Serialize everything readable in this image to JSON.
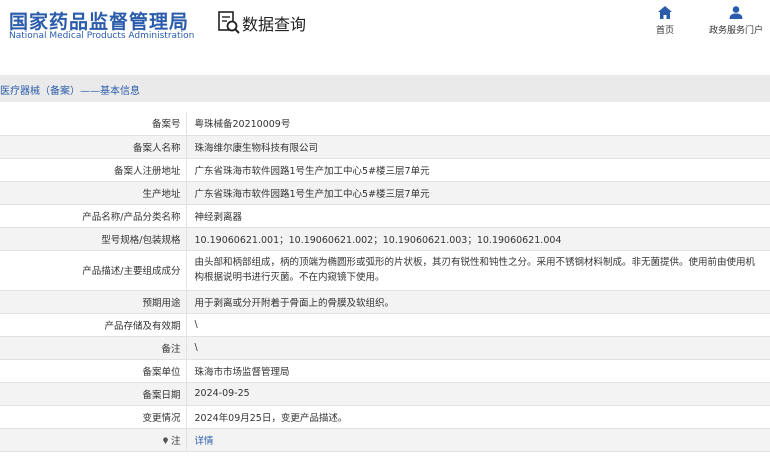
{
  "header": {
    "logo_cn": "国家药品监督管理局",
    "logo_en": "National Medical Products Administration",
    "query_title": "数据查询",
    "nav": {
      "home": "首页",
      "portal": "政务服务门户"
    }
  },
  "breadcrumb": "医疗器械（备案）——基本信息",
  "detail": {
    "rows": [
      {
        "label": "备案号",
        "value": "粤珠械备20210009号"
      },
      {
        "label": "备案人名称",
        "value": "珠海维尔康生物科技有限公司"
      },
      {
        "label": "备案人注册地址",
        "value": "广东省珠海市软件园路1号生产加工中心5#楼三层7单元"
      },
      {
        "label": "生产地址",
        "value": "广东省珠海市软件园路1号生产加工中心5#楼三层7单元"
      },
      {
        "label": "产品名称/产品分类名称",
        "value": "神经剥离器"
      },
      {
        "label": "型号规格/包装规格",
        "value": "10.19060621.001；10.19060621.002；10.19060621.003；10.19060621.004"
      },
      {
        "label": "产品描述/主要组成成分",
        "value": "由头部和柄部组成，柄的顶端为椭圆形或弧形的片状板，其刃有锐性和钝性之分。采用不锈钢材料制成。非无菌提供。使用前由使用机构根据说明书进行灭菌。不在内窥镜下使用。"
      },
      {
        "label": "预期用途",
        "value": "用于剥离或分开附着于骨面上的骨膜及软组织。"
      },
      {
        "label": "产品存储及有效期",
        "value": "\\"
      },
      {
        "label": "备注",
        "value": "\\"
      },
      {
        "label": "备案单位",
        "value": "珠海市市场监督管理局"
      },
      {
        "label": "备案日期",
        "value": "2024-09-25"
      },
      {
        "label": "变更情况",
        "value": "2024年09月25日，变更产品描述。"
      },
      {
        "label": "注",
        "value": "详情"
      }
    ]
  },
  "colors": {
    "brand": "#2a5cab",
    "bar_bg": "#eaeaea",
    "row_alt": "#f3f3f3"
  }
}
